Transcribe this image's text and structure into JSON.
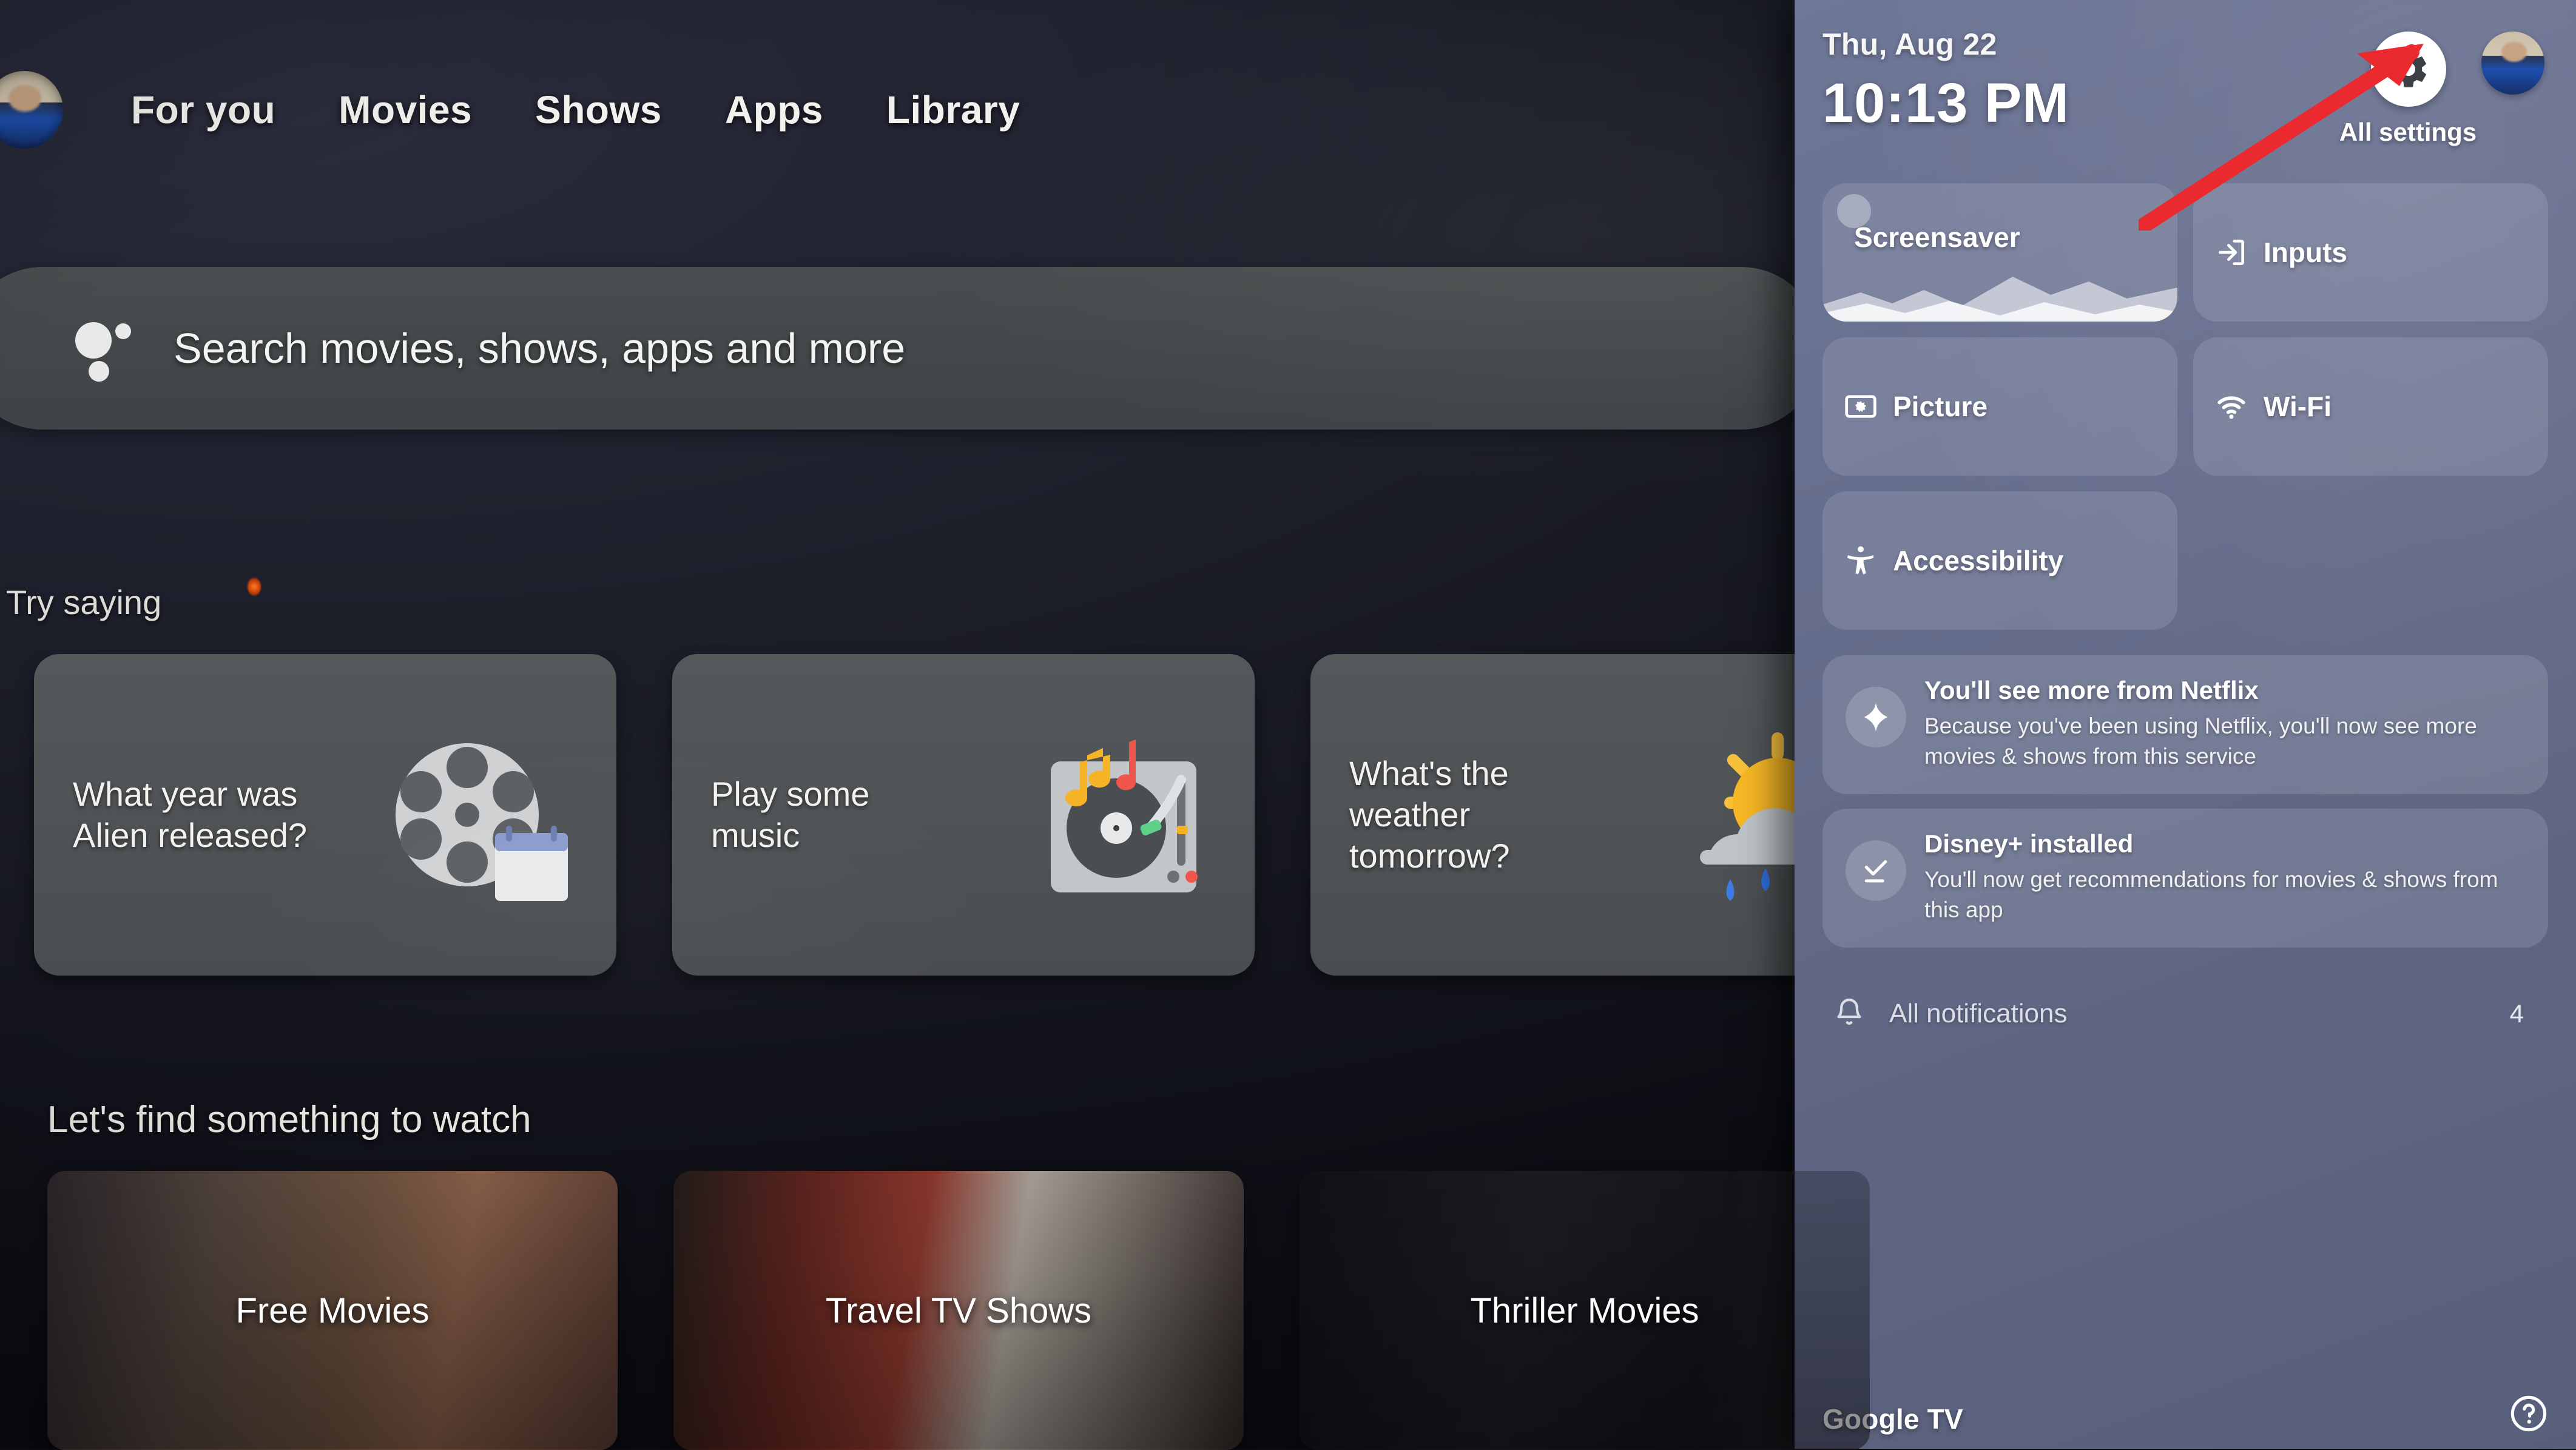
{
  "tv": {
    "nav": {
      "avatar_name": "profile-avatar",
      "items": [
        {
          "label": "For you"
        },
        {
          "label": "Movies"
        },
        {
          "label": "Shows"
        },
        {
          "label": "Apps"
        },
        {
          "label": "Library"
        }
      ]
    },
    "search": {
      "placeholder": "Search movies, shows, apps and more",
      "icon": "google-assistant-icon"
    },
    "try_saying": {
      "heading": "Try saying",
      "cards": [
        {
          "text": "What year was Alien released?",
          "art": "film-reel-calendar-icon"
        },
        {
          "text": "Play some music",
          "art": "turntable-music-notes-icon"
        },
        {
          "text": "What's the weather tomorrow?",
          "art": "sun-rain-cloud-icon"
        }
      ]
    },
    "watch_row": {
      "heading": "Let's find something to watch",
      "tiles": [
        {
          "label": "Free Movies"
        },
        {
          "label": "Travel TV Shows"
        },
        {
          "label": "Thriller Movies"
        }
      ]
    }
  },
  "panel": {
    "date": "Thu, Aug 22",
    "time": "10:13 PM",
    "settings_button": {
      "label": "All settings",
      "icon": "gear-icon"
    },
    "avatar_name": "panel-profile-avatar",
    "tiles": [
      {
        "label": "Screensaver",
        "icon": "screensaver-landscape-icon"
      },
      {
        "label": "Inputs",
        "icon": "input-arrow-icon"
      },
      {
        "label": "Picture",
        "icon": "picture-brightness-icon"
      },
      {
        "label": "Wi-Fi",
        "icon": "wifi-icon"
      },
      {
        "label": "Accessibility",
        "icon": "accessibility-person-icon"
      }
    ],
    "notifications": [
      {
        "title": "You'll see more from Netflix",
        "body": "Because you've been using Netflix, you'll now see more movies & shows from this service",
        "icon": "sparkle-icon"
      },
      {
        "title": "Disney+ installed",
        "body": "You'll now get recommendations for movies & shows from this app",
        "icon": "check-download-icon"
      }
    ],
    "all_notifications": {
      "label": "All notifications",
      "count": "4",
      "icon": "bell-icon"
    },
    "brand": "Google TV",
    "help": {
      "icon": "help-circle-icon"
    }
  },
  "annotation": {
    "arrow": {
      "color": "#ea2a2f",
      "points_to": "All settings gear button"
    }
  },
  "colors": {
    "panel_bg": "#676f8e",
    "tv_bg": "#1d1f2b",
    "accent_red": "#ea2a2f",
    "tile_fill": "rgba(255,255,255,0.12)"
  }
}
